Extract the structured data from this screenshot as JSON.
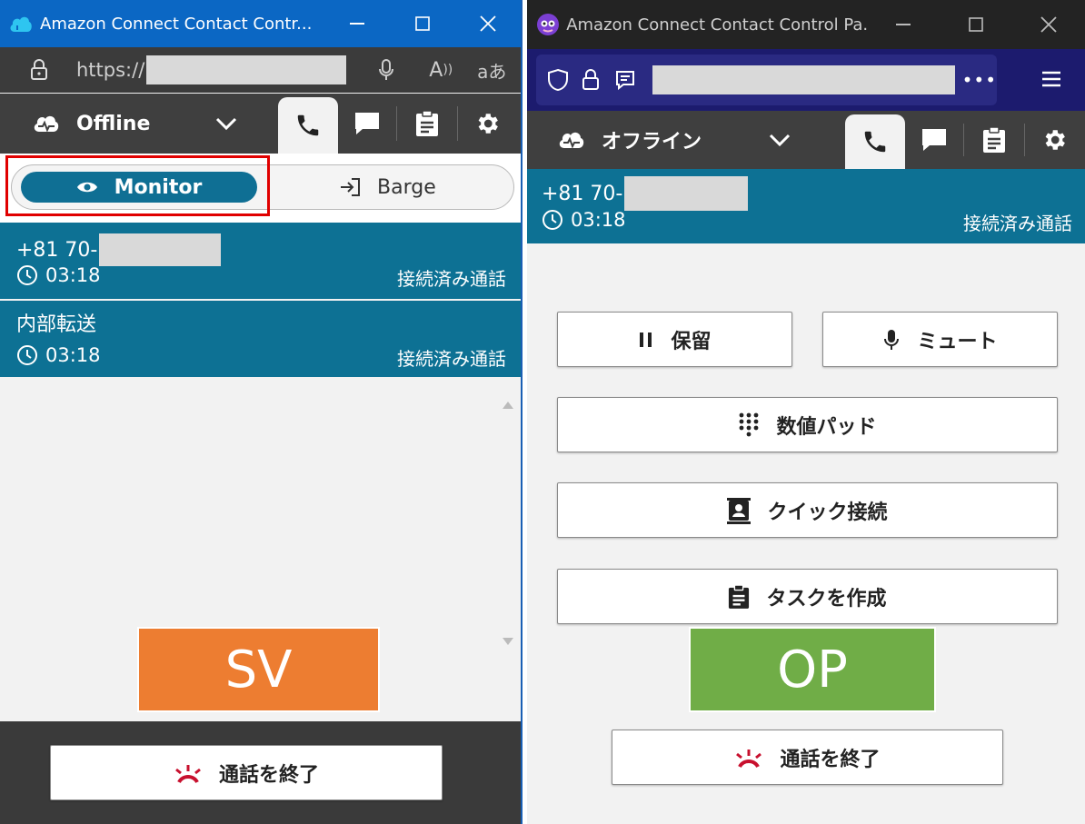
{
  "left_window": {
    "title": "Amazon Connect Contact Contr...",
    "address_prefix": "https://",
    "ccp": {
      "status": "Offline",
      "mode_toggle": {
        "monitor_label": "Monitor",
        "barge_label": "Barge"
      },
      "calls": [
        {
          "number": "+81 70-",
          "timer": "03:18",
          "state": "接続済み通話"
        },
        {
          "label": "内部転送",
          "timer": "03:18",
          "state": "接続済み通話"
        }
      ],
      "role_label": "SV",
      "role_color": "#ED7D31",
      "end_call_label": "通話を終了"
    }
  },
  "right_window": {
    "title": "Amazon Connect Contact Control Pa...",
    "ccp": {
      "status": "オフライン",
      "call": {
        "number": "+81 70-",
        "timer": "03:18",
        "state": "接続済み通話"
      },
      "buttons": {
        "hold": "保留",
        "mute": "ミュート",
        "keypad": "数値パッド",
        "quick_connect": "クイック接続",
        "create_task": "タスクを作成"
      },
      "role_label": "OP",
      "role_color": "#70AD47",
      "end_call_label": "通話を終了"
    }
  },
  "colors": {
    "accent": "#0D7194",
    "end_call_icon": "#C8102E",
    "highlight": "#E00000"
  }
}
